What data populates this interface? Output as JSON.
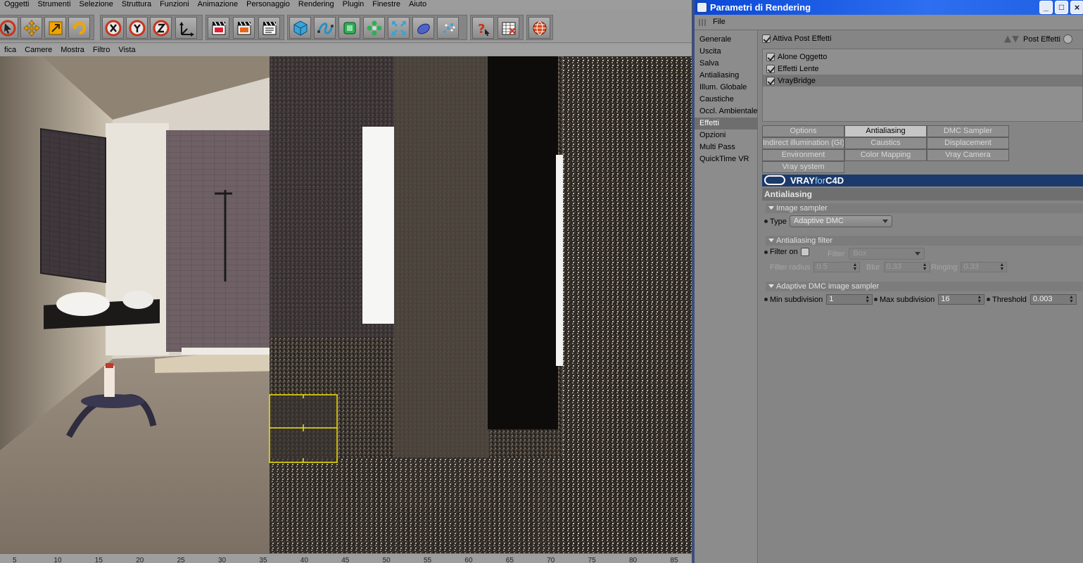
{
  "main": {
    "menu": [
      "Oggetti",
      "Strumenti",
      "Selezione",
      "Struttura",
      "Funzioni",
      "Animazione",
      "Personaggio",
      "Rendering",
      "Plugin",
      "Finestre",
      "Aiuto"
    ],
    "view_menu": [
      "fica",
      "Camere",
      "Mostra",
      "Filtro",
      "Vista"
    ],
    "toolbar_icons": [
      "pointer-icon",
      "move-icon",
      "scale-icon",
      "rotate-icon",
      "x-axis-icon",
      "y-axis-icon",
      "z-axis-icon",
      "coordinate-system-icon",
      "render-view-icon",
      "render-picture-viewer-icon",
      "render-settings-icon",
      "cube-primitive-icon",
      "spline-icon",
      "nurbs-icon",
      "array-icon",
      "deformer-icon",
      "scene-icon",
      "particle-icon",
      "help-icon",
      "xpresso-icon",
      "globe-icon"
    ],
    "ruler_ticks": [
      "5",
      "10",
      "15",
      "20",
      "25",
      "30",
      "35",
      "40",
      "45",
      "50",
      "55",
      "60",
      "65",
      "70",
      "75",
      "80",
      "85"
    ]
  },
  "dialog": {
    "title": "Parametri di Rendering",
    "file_menu": "File",
    "window_buttons": {
      "minimize": "_",
      "maximize": "□",
      "close": "×"
    },
    "categories": [
      {
        "label": "Generale"
      },
      {
        "label": "Uscita"
      },
      {
        "label": "Salva"
      },
      {
        "label": "Antialiasing"
      },
      {
        "label": "Illum. Globale"
      },
      {
        "label": "Caustiche"
      },
      {
        "label": "Occl. Ambientale"
      },
      {
        "label": "Effetti"
      },
      {
        "label": "Opzioni"
      },
      {
        "label": "Multi Pass"
      },
      {
        "label": "QuickTime VR"
      }
    ],
    "selected_category": "Effetti",
    "post_effects": {
      "enable_label": "Attiva Post Effetti",
      "enabled": true,
      "menu_label": "Post Effetti",
      "items": [
        {
          "label": "Alone Oggetto",
          "checked": true
        },
        {
          "label": "Effetti Lente",
          "checked": true
        },
        {
          "label": "VrayBridge",
          "checked": true
        }
      ],
      "selected_item": "VrayBridge"
    },
    "vray_tabs": [
      {
        "label": "Options"
      },
      {
        "label": "Antialiasing"
      },
      {
        "label": "DMC Sampler"
      },
      {
        "label": "Indirect illumination (GI)"
      },
      {
        "label": "Caustics"
      },
      {
        "label": "Displacement"
      },
      {
        "label": "Environment"
      },
      {
        "label": "Color Mapping"
      },
      {
        "label": "Vray Camera"
      },
      {
        "label": "Vray system"
      }
    ],
    "active_tab": "Antialiasing",
    "banner": {
      "vray": "VRAY",
      "for": "for",
      "c4d": "C4D"
    },
    "section_title": "Antialiasing",
    "image_sampler": {
      "group_label": "Image sampler",
      "type_label": "Type",
      "type_value": "Adaptive DMC"
    },
    "aa_filter": {
      "group_label": "Antialiasing filter",
      "filter_on_label": "Filter on",
      "filter_on": false,
      "filter_label": "Filter",
      "filter_value": "Box",
      "radius_label": "Filter radius",
      "radius_value": "0.5",
      "blur_label": "Blur",
      "blur_value": "0.33",
      "ringing_label": "Ringing",
      "ringing_value": "0.33"
    },
    "adaptive_dmc": {
      "group_label": "Adaptive DMC image sampler",
      "min_label": "Min subdivision",
      "min_value": "1",
      "max_label": "Max subdivision",
      "max_value": "16",
      "threshold_label": "Threshold",
      "threshold_value": "0.003"
    }
  },
  "colors": {
    "title_bar": "#1f5fe3",
    "vray_banner": "#1b3a6b",
    "bucket_outline": "#f2e600",
    "panel_bg": "#858585"
  }
}
